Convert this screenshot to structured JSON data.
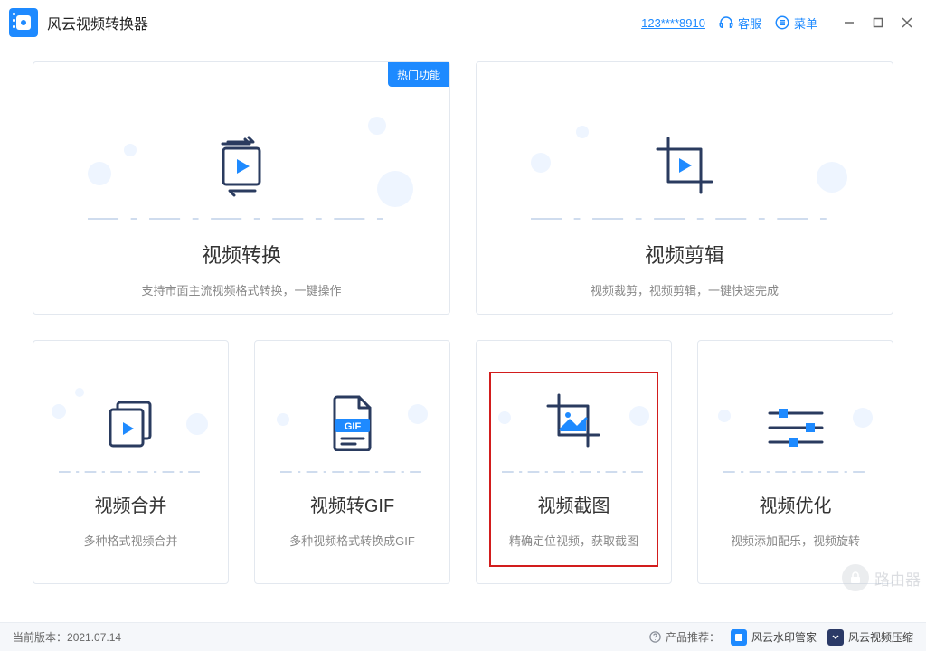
{
  "app": {
    "title": "风云视频转换器"
  },
  "header": {
    "user_id": "123****8910",
    "support_label": "客服",
    "menu_label": "菜单"
  },
  "badges": {
    "hot": "热门功能"
  },
  "cards": {
    "convert": {
      "title": "视频转换",
      "desc": "支持市面主流视频格式转换，一键操作"
    },
    "edit": {
      "title": "视频剪辑",
      "desc": "视频裁剪，视频剪辑，一键快速完成"
    },
    "merge": {
      "title": "视频合并",
      "desc": "多种格式视频合并"
    },
    "gif": {
      "title": "视频转GIF",
      "desc": "多种视频格式转换成GIF",
      "icon_text": "GIF"
    },
    "screenshot": {
      "title": "视频截图",
      "desc": "精确定位视频，获取截图"
    },
    "optimize": {
      "title": "视频优化",
      "desc": "视频添加配乐，视频旋转"
    }
  },
  "status": {
    "version_label": "当前版本：",
    "version_value": "2021.07.14",
    "recommend_label": "产品推荐：",
    "products": [
      {
        "name": "风云水印管家"
      },
      {
        "name": "风云视频压缩"
      }
    ]
  },
  "watermark": {
    "text": "路由器"
  },
  "colors": {
    "accent": "#1e8aff",
    "highlight": "#d21d1d"
  }
}
